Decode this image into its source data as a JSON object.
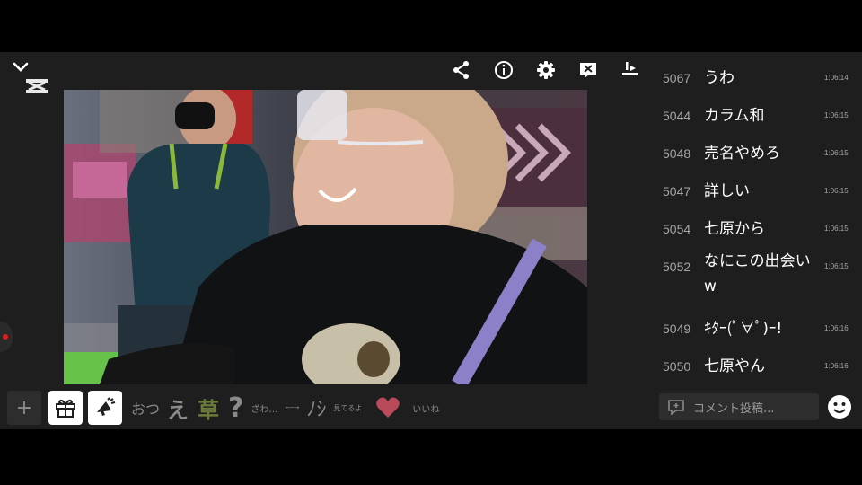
{
  "toolbar": {
    "icons": [
      "share-icon",
      "info-icon",
      "gear-icon",
      "comment-off-icon",
      "toolbar-adjust-icon"
    ]
  },
  "quickbar": {
    "plus_label": "+",
    "stamps": [
      "おつ",
      "え",
      "草",
      "?",
      "ざわ…",
      "←─→",
      "ﾉｼ",
      "見てるよ",
      "いいね"
    ]
  },
  "comments": [
    {
      "no": "5067",
      "text": "うわ",
      "time": "1:06:14"
    },
    {
      "no": "5044",
      "text": "カラム和",
      "time": "1:06:15"
    },
    {
      "no": "5048",
      "text": "売名やめろ",
      "time": "1:06:15"
    },
    {
      "no": "5047",
      "text": "詳しい",
      "time": "1:06:15"
    },
    {
      "no": "5054",
      "text": "七原から",
      "time": "1:06:15"
    },
    {
      "no": "5052",
      "text": "なにこの出会いw",
      "time": "1:06:15"
    },
    {
      "no": "5049",
      "text": "ｷﾀｰ(ﾟ∀ﾟ)ｰ!",
      "time": "1:06:16"
    },
    {
      "no": "5050",
      "text": "七原やん",
      "time": "1:06:16"
    }
  ],
  "comment_input": {
    "placeholder": "コメント投稿..."
  },
  "colors": {
    "panel_bg": "#1e1e1e",
    "heart": "#b84a5a",
    "grass": "#6b7b3a",
    "strap": "#8c80c8"
  }
}
